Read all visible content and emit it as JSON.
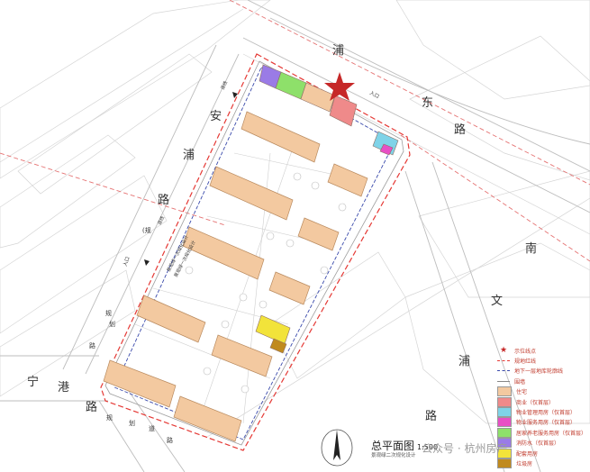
{
  "roads": {
    "north": [
      "浦"
    ],
    "north_east": [
      "东",
      "路"
    ],
    "west": [
      "安",
      "浦",
      "路"
    ],
    "south_west": [
      "宁",
      "港",
      "路"
    ],
    "south_small": [
      "规",
      "划",
      "道",
      "路"
    ],
    "east": [
      "南",
      "文",
      "浦",
      "路"
    ],
    "west_small": [
      "规",
      "划",
      "道",
      "路"
    ],
    "stub_west": "(规",
    "stub_south": "路"
  },
  "roadside_labels": {
    "north_gate": "入口",
    "west_gate": "入口",
    "north_note": "退线",
    "west_note": "退线"
  },
  "site_notes": {
    "center": "景观绿一次规化设计",
    "center_sub": "景观绿一次规化设计"
  },
  "legend": {
    "items": [
      {
        "label": "示位线点",
        "symbol": "star",
        "color": "#c62828"
      },
      {
        "label": "规地红线",
        "symbol": "dash-red",
        "color": "#e53935"
      },
      {
        "label": "地下一层地库轮廓线",
        "symbol": "dash-blue",
        "color": "#3949ab"
      },
      {
        "label": "围墙",
        "symbol": "line-grey",
        "color": "#888888"
      },
      {
        "label": "住宅",
        "symbol": "fill",
        "color": "#f3c9a0"
      },
      {
        "label": "商业（仅首层）",
        "symbol": "fill",
        "color": "#ef8a8a"
      },
      {
        "label": "物业管理用房（仅首层）",
        "symbol": "fill",
        "color": "#7fd3e8"
      },
      {
        "label": "物业服务用房（仅首层）",
        "symbol": "fill",
        "color": "#e84fc5"
      },
      {
        "label": "居家养老服务用房（仅首层）",
        "symbol": "fill",
        "color": "#8ee06a"
      },
      {
        "label": "消防水（仅首层）",
        "symbol": "fill",
        "color": "#9a7be6"
      },
      {
        "label": "配套用房",
        "symbol": "fill",
        "color": "#f2e33a"
      },
      {
        "label": "垃圾房",
        "symbol": "fill",
        "color": "#c08a1e"
      }
    ]
  },
  "title": {
    "main": "总平面图",
    "scale": "1:500",
    "sub": "景观绿二次规化设计"
  },
  "watermark": "公众号 · 杭州房产",
  "colors": {
    "residential": "#f3c9a0",
    "commercial": "#ef8a8a",
    "property": "#7fd3e8",
    "service": "#e84fc5",
    "elderly": "#8ee06a",
    "fire": "#9a7be6",
    "support": "#f2e33a",
    "garbage": "#c08a1e",
    "redline": "#e53935",
    "basement": "#3949ab",
    "star": "#c62828"
  }
}
